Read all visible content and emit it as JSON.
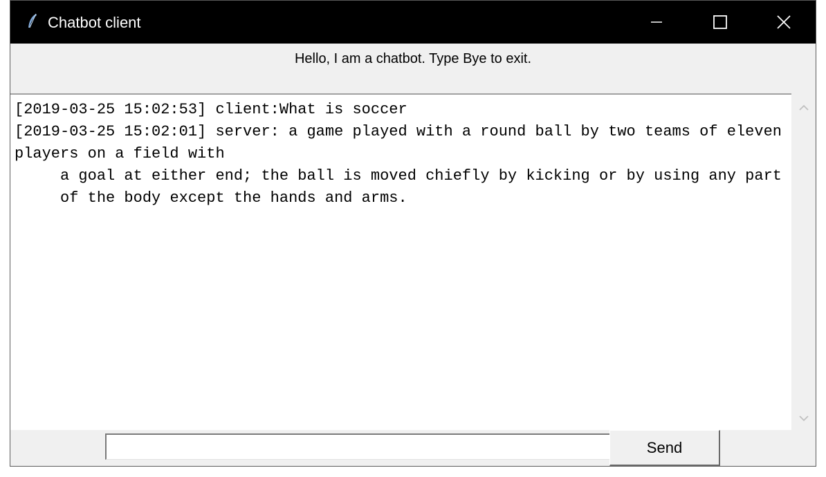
{
  "window": {
    "title": "Chatbot client",
    "icon": "feather-icon"
  },
  "greeting": "Hello, I am a chatbot. Type Bye to exit.",
  "chat": {
    "log": "[2019-03-25 15:02:53] client:What is soccer\n[2019-03-25 15:02:01] server: a game played with a round ball by two teams of eleven players on a field with\n     a goal at either end; the ball is moved chiefly by kicking or by using any part\n     of the body except the hands and arms."
  },
  "input": {
    "value": ""
  },
  "send_button": {
    "label": "Send"
  },
  "colors": {
    "titlebar": "#000000",
    "window_bg": "#f0f0f0",
    "chat_bg": "#ffffff"
  }
}
